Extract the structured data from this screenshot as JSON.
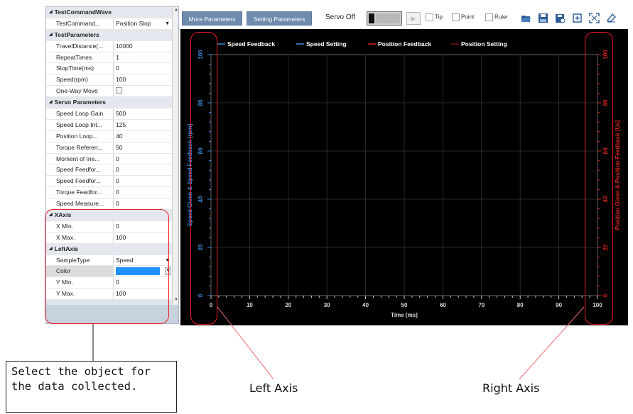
{
  "property_grid": {
    "rows": [
      {
        "kind": "category",
        "label": "TestCommandWave"
      },
      {
        "kind": "prop",
        "name": "TestCommand...",
        "value": "Position Slop",
        "dropdown": true
      },
      {
        "kind": "category",
        "label": "TestParameters"
      },
      {
        "kind": "prop",
        "name": "TravelDistance(...",
        "value": "10000"
      },
      {
        "kind": "prop",
        "name": "RepeatTimes",
        "value": "1"
      },
      {
        "kind": "prop",
        "name": "StopTime(ms)",
        "value": "0"
      },
      {
        "kind": "prop",
        "name": "Speed(rpm)",
        "value": "100"
      },
      {
        "kind": "prop",
        "name": "One-Way Move",
        "value": "",
        "checkbox": true
      },
      {
        "kind": "category",
        "label": "Servo Parameters"
      },
      {
        "kind": "prop",
        "name": "Speed Loop Gain",
        "value": "500"
      },
      {
        "kind": "prop",
        "name": "Speed Loop Int...",
        "value": "125"
      },
      {
        "kind": "prop",
        "name": "Position Loop...",
        "value": "40"
      },
      {
        "kind": "prop",
        "name": "Torque Referen...",
        "value": "50"
      },
      {
        "kind": "prop",
        "name": "Moment of Ine...",
        "value": "0"
      },
      {
        "kind": "prop",
        "name": "Speed Feedfor...",
        "value": "0"
      },
      {
        "kind": "prop",
        "name": "Speed Feedfor...",
        "value": "0"
      },
      {
        "kind": "prop",
        "name": "Torque Feedfor...",
        "value": "0"
      },
      {
        "kind": "prop",
        "name": "Speed Measure...",
        "value": "0"
      },
      {
        "kind": "category",
        "label": "XAxis"
      },
      {
        "kind": "prop",
        "name": "X Min.",
        "value": "0"
      },
      {
        "kind": "prop",
        "name": "X Max.",
        "value": "100"
      },
      {
        "kind": "category",
        "label": "LeftAxis"
      },
      {
        "kind": "prop",
        "name": "SampleType",
        "value": "Speed",
        "dropdown": true
      },
      {
        "kind": "prop",
        "name": "Color",
        "value": "",
        "color": "#1e90ff",
        "selected": true
      },
      {
        "kind": "prop",
        "name": "Y Min.",
        "value": "0"
      },
      {
        "kind": "prop",
        "name": "Y Max.",
        "value": "100"
      }
    ]
  },
  "toolbar": {
    "more_params_label": "More Parameters",
    "setting_params_label": "Setting Parameters",
    "servo_label": "Servo Off",
    "tip_label": "Tip",
    "point_label": "Point",
    "ruler_label": "Ruler",
    "icons": [
      "open-folder-icon",
      "save-icon",
      "save-as-icon",
      "zoom-in-icon",
      "fit-screen-icon",
      "eraser-icon"
    ]
  },
  "chart_data": {
    "type": "line",
    "legend": [
      {
        "name": "Speed Feedback",
        "color": "#3a8dde"
      },
      {
        "name": "Speed Setting",
        "color": "#3a8dde"
      },
      {
        "name": "Position Feedback",
        "color": "#d9261c"
      },
      {
        "name": "Position Setting",
        "color": "#7a1410"
      }
    ],
    "legend_placement": "top",
    "xlabel": "Time [ms]",
    "xlim": [
      0,
      100
    ],
    "x_ticks": [
      "0",
      "10",
      "20",
      "30",
      "40",
      "50",
      "60",
      "70",
      "80",
      "90",
      "100"
    ],
    "ylabel_left": "Speed Given & Speed Feedback [rpm]",
    "ylim_left": [
      0,
      100
    ],
    "y_ticks_left": [
      "0",
      "20",
      "40",
      "60",
      "80",
      "100"
    ],
    "ylabel_right": "Position Given & Position Feedback [Ux]",
    "ylim_right": [
      0,
      100
    ],
    "y_ticks_right": [
      "0",
      "20",
      "40",
      "60",
      "80",
      "100"
    ],
    "grid": true,
    "series": []
  },
  "annotations": {
    "callout_line1": "Select the object for",
    "callout_line2": "the data collected.",
    "left_axis_label": "Left Axis",
    "right_axis_label": "Right Axis",
    "highlight_color": "#ef1c25"
  }
}
